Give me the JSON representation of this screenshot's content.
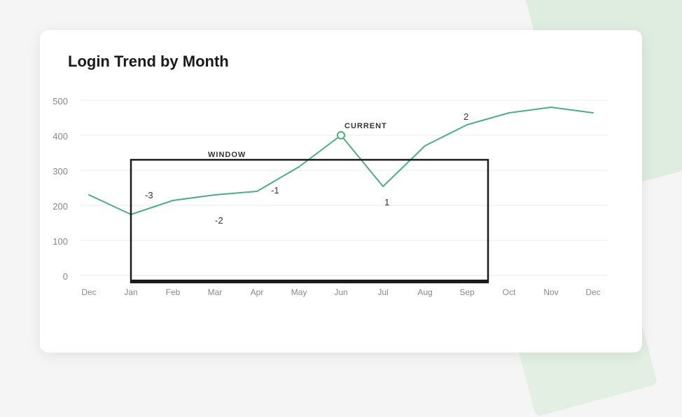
{
  "title": "Login Trend by Month",
  "chart": {
    "yAxis": {
      "labels": [
        "500",
        "400",
        "300",
        "200",
        "100",
        "0"
      ]
    },
    "xAxis": {
      "labels": [
        "Dec",
        "Jan",
        "Feb",
        "Mar",
        "Apr",
        "May",
        "Jun",
        "Jul",
        "Aug",
        "Sep",
        "Oct",
        "Nov",
        "Dec"
      ]
    },
    "window_label": "WINDOW",
    "current_label": "CURRENT",
    "offsets": {
      "-3": "-3",
      "-2": "-2",
      "-1": "-1",
      "1": "1",
      "2": "2"
    },
    "accent_color": "#4caf7d",
    "line_color": "#4caf7d"
  }
}
